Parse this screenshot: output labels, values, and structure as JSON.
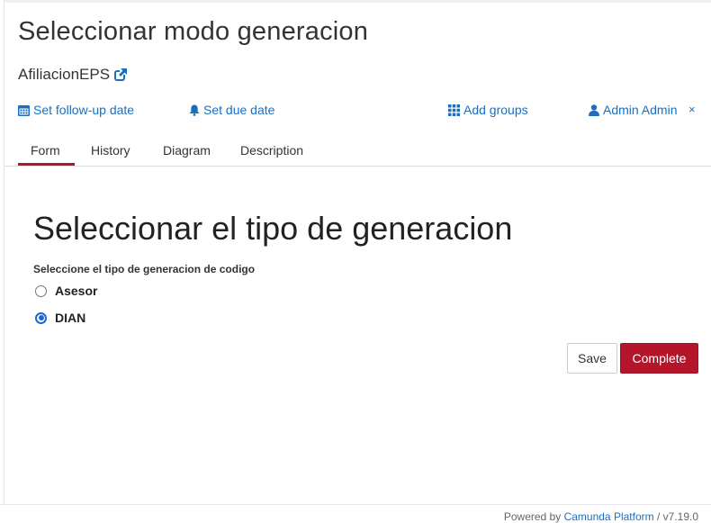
{
  "task": {
    "title": "Seleccionar modo generacion",
    "process_name": "AfiliacionEPS"
  },
  "actions": {
    "follow_up": "Set follow-up date",
    "due_date": "Set due date",
    "add_groups": "Add groups",
    "assignee": "Admin Admin",
    "remove_assignee": "×"
  },
  "tabs": [
    {
      "label": "Form",
      "active": true
    },
    {
      "label": "History",
      "active": false
    },
    {
      "label": "Diagram",
      "active": false
    },
    {
      "label": "Description",
      "active": false
    }
  ],
  "form": {
    "heading": "Seleccionar el tipo de generacion",
    "field_label": "Seleccione el tipo de generacion de codigo",
    "options": [
      {
        "label": "Asesor",
        "checked": false
      },
      {
        "label": "DIAN",
        "checked": true
      }
    ],
    "save_label": "Save",
    "complete_label": "Complete"
  },
  "footer": {
    "powered_by": "Powered by",
    "link": "Camunda Platform",
    "version": "/ v7.19.0"
  },
  "colors": {
    "accent": "#b5152b",
    "link": "#1a6fc1",
    "radio_selected": "#1f66d4"
  }
}
